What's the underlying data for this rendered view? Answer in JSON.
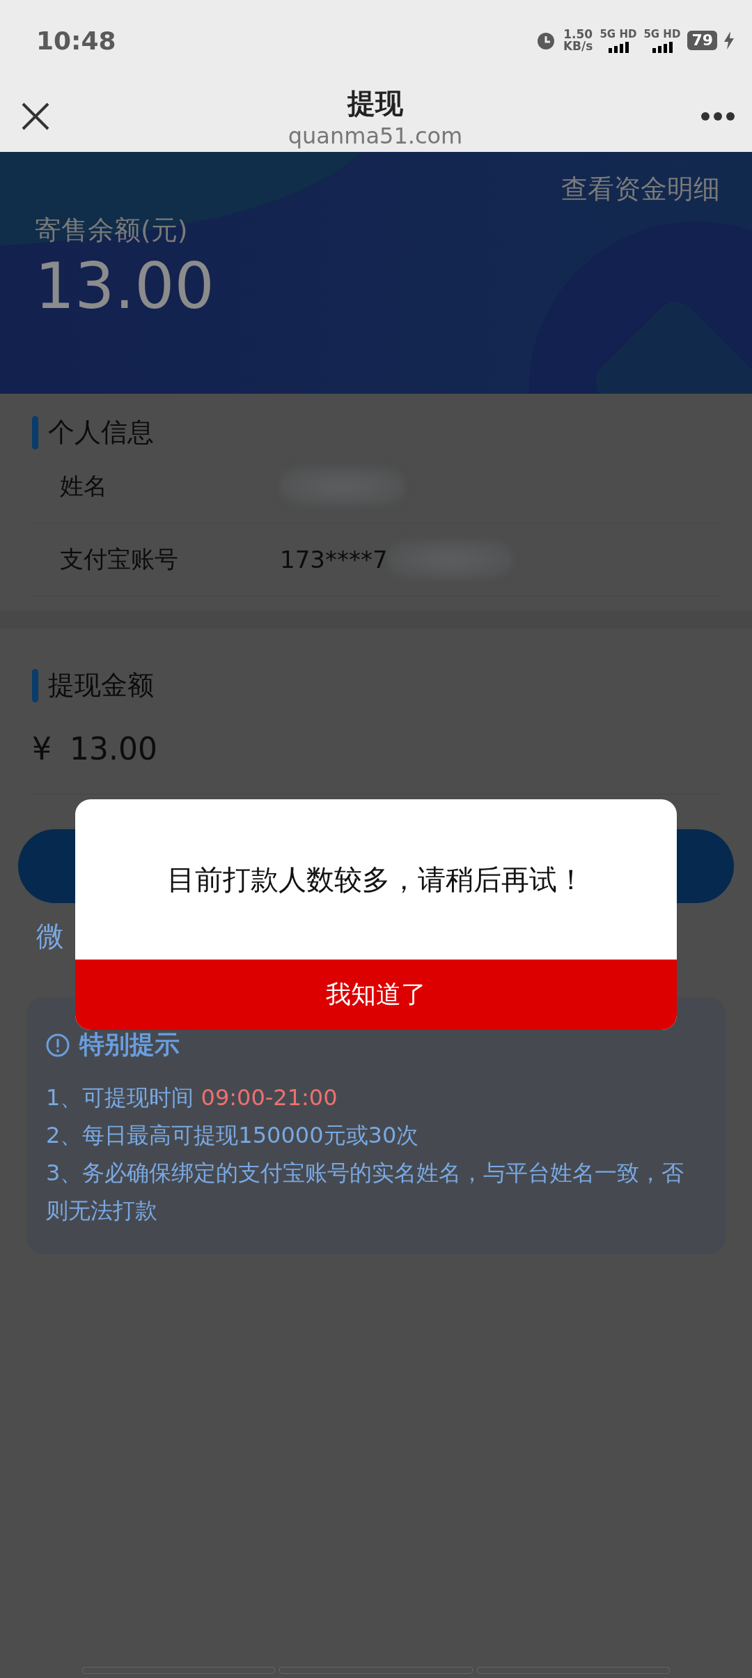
{
  "status_bar": {
    "time": "10:48",
    "net_speed": "1.50",
    "net_unit": "KB/s",
    "sim_labels": [
      "5G HD",
      "5G HD"
    ],
    "battery": "79"
  },
  "header": {
    "title": "提现",
    "subtitle": "quanma51.com"
  },
  "banner": {
    "link": "查看资金明细",
    "label": "寄售余额(元)",
    "balance": "13.00"
  },
  "personal_info": {
    "title": "个人信息",
    "rows": [
      {
        "label": "姓名",
        "value": "",
        "blurred": true
      },
      {
        "label": "支付宝账号",
        "value": "173****7",
        "blurred": true
      }
    ]
  },
  "withdraw": {
    "title": "提现金额",
    "currency": "¥",
    "amount": "13.00",
    "link": "微"
  },
  "tips": {
    "title": "特别提示",
    "lines": [
      {
        "text": "1、可提现时间 ",
        "highlight": "09:00-21:00"
      },
      {
        "text": "2、每日最高可提现150000元或30次"
      },
      {
        "text": "3、务必确保绑定的支付宝账号的实名姓名，与平台姓名一致，否则无法打款"
      }
    ]
  },
  "dialog": {
    "message": "目前打款人数较多，请稍后再试！",
    "button": "我知道了"
  }
}
